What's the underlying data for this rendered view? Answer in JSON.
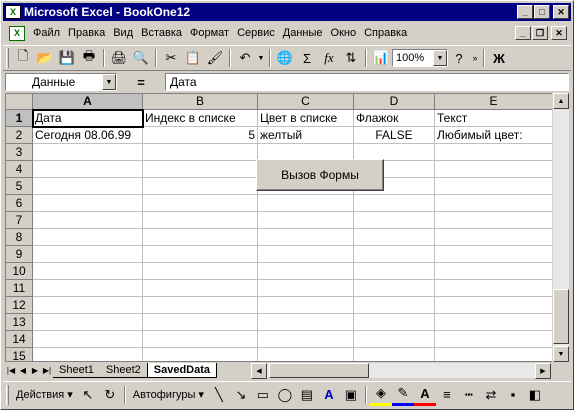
{
  "window": {
    "title": "Microsoft Excel - BookOne12",
    "app_icon": "X"
  },
  "menu": [
    "Файл",
    "Правка",
    "Вид",
    "Вставка",
    "Формат",
    "Сервис",
    "Данные",
    "Окно",
    "Справка"
  ],
  "toolbar": {
    "zoom": "100%",
    "bold": "Ж"
  },
  "formula_bar": {
    "name_box": "Данные",
    "equals": "=",
    "content": "Дата"
  },
  "columns": [
    "A",
    "B",
    "C",
    "D",
    "E"
  ],
  "rows": [
    "1",
    "2",
    "3",
    "4",
    "5",
    "6",
    "7",
    "8",
    "9",
    "10",
    "11",
    "12",
    "13",
    "14",
    "15"
  ],
  "cells": {
    "r1": [
      "Дата",
      "Индекс в списке",
      "Цвет в списке",
      "Флажок",
      "Текст"
    ],
    "r2": [
      "Сегодня 08.06.99",
      "5",
      "желтый",
      "FALSE",
      "Любимый цвет:"
    ]
  },
  "form_button": "Вызов Формы",
  "tabs": [
    "Sheet1",
    "Sheet2",
    "SavedData"
  ],
  "drawing": {
    "actions": "Действия",
    "autoshapes": "Автофигуры"
  }
}
